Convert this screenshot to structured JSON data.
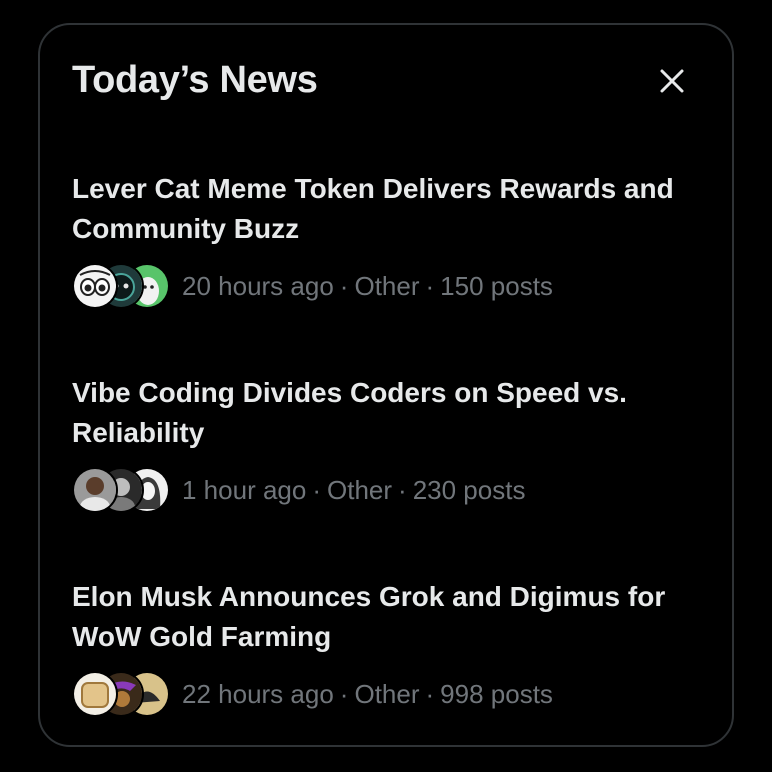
{
  "panel": {
    "title": "Today’s News",
    "close_icon": "close-icon"
  },
  "news": [
    {
      "headline": "Lever Cat Meme Token Delivers Rewards and Community Buzz",
      "time": "20 hours ago",
      "category": "Other",
      "posts": "150 posts",
      "separator": "·",
      "avatars": [
        "cartoon-cat-avatar",
        "dark-cat-avatar",
        "green-character-avatar"
      ]
    },
    {
      "headline": "Vibe Coding Divides Coders on Speed vs. Reliability",
      "time": "1 hour ago",
      "category": "Other",
      "posts": "230 posts",
      "separator": "·",
      "avatars": [
        "man-portrait-avatar",
        "bw-portrait-avatar",
        "woman-sketch-avatar"
      ]
    },
    {
      "headline": "Elon Musk Announces Grok and Digimus for WoW Gold Farming",
      "time": "22 hours ago",
      "category": "Other",
      "posts": "998 posts",
      "separator": "·",
      "avatars": [
        "bread-avatar",
        "purple-figure-avatar",
        "gold-creature-avatar"
      ]
    }
  ],
  "colors": {
    "background": "#000000",
    "border": "#2f3336",
    "text_primary": "#e7e9ea",
    "text_secondary": "#71767b"
  }
}
